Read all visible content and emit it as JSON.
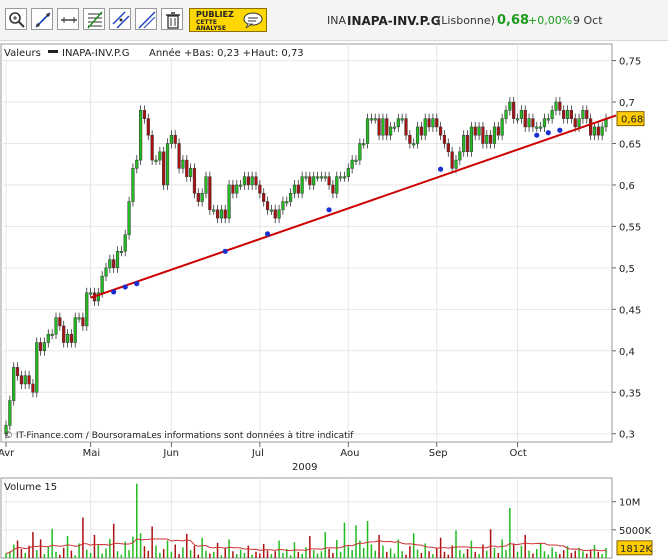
{
  "header": {
    "ticker": "INA",
    "name": "INAPA-INV.P.G",
    "exchange": "(Lisbonne)",
    "price": "0,68",
    "change": "+0,00%",
    "date": "9 Oct",
    "ad_line1": "PUBLIEZ",
    "ad_line2": "CETTE",
    "ad_line3": "ANALYSE"
  },
  "toolbar": [
    {
      "icon": "zoom-icon"
    },
    {
      "icon": "trendline-icon"
    },
    {
      "icon": "horizontal-line-icon"
    },
    {
      "icon": "fibonacci-icon"
    },
    {
      "icon": "channel-icon"
    },
    {
      "icon": "parallel-line-icon"
    },
    {
      "icon": "trash-icon"
    }
  ],
  "colors": {
    "up": "#22bb22",
    "down": "#aa1111",
    "trend": "#cc0000",
    "price_tag": "#ffcc00",
    "volume_avg": "#cc3333"
  },
  "chart_data": [
    {
      "type": "candlestick",
      "legend_label": "Valeurs",
      "series_name": "INAPA-INV.P.G",
      "legend_stats": "Année +Bas: 0,23 +Haut: 0,73",
      "credit": "© IT-Finance.com / BoursoramaLes informations sont données à titre indicatif",
      "x_ticks": [
        "Avr",
        "Mai",
        "Jun",
        "Jul",
        "Aou",
        "Sep",
        "Oct"
      ],
      "x_year": "2009",
      "y_ticks": [
        "0,75",
        "0,7",
        "0,65",
        "0,6",
        "0,55",
        "0,5",
        "0,45",
        "0,4",
        "0,35",
        "0,3"
      ],
      "y_tick_values": [
        0.75,
        0.7,
        0.65,
        0.6,
        0.55,
        0.5,
        0.45,
        0.4,
        0.35,
        0.3
      ],
      "ylim": [
        0.29,
        0.77
      ],
      "last_price_label": "0,68",
      "last_price_value": 0.68,
      "trendline": [
        [
          0.464,
          0.464
        ],
        [
          0.685,
          0.685
        ]
      ],
      "trendline_day": [
        22,
        153
      ],
      "touch_points": [
        [
          28,
          0.471
        ],
        [
          31,
          0.477
        ],
        [
          34,
          0.481
        ],
        [
          57,
          0.52
        ],
        [
          68,
          0.541
        ],
        [
          84,
          0.57
        ],
        [
          113,
          0.619
        ],
        [
          138,
          0.66
        ],
        [
          141,
          0.663
        ],
        [
          144,
          0.666
        ]
      ],
      "day_range": [
        0,
        156
      ],
      "close": [
        0.31,
        0.34,
        0.38,
        0.37,
        0.36,
        0.37,
        0.36,
        0.35,
        0.41,
        0.4,
        0.41,
        0.42,
        0.42,
        0.44,
        0.43,
        0.41,
        0.42,
        0.41,
        0.44,
        0.44,
        0.43,
        0.47,
        0.47,
        0.46,
        0.47,
        0.49,
        0.5,
        0.51,
        0.5,
        0.52,
        0.52,
        0.54,
        0.58,
        0.62,
        0.63,
        0.69,
        0.68,
        0.66,
        0.63,
        0.63,
        0.64,
        0.6,
        0.65,
        0.66,
        0.65,
        0.62,
        0.63,
        0.61,
        0.62,
        0.59,
        0.58,
        0.59,
        0.61,
        0.57,
        0.57,
        0.56,
        0.57,
        0.56,
        0.6,
        0.59,
        0.6,
        0.6,
        0.61,
        0.6,
        0.61,
        0.6,
        0.59,
        0.58,
        0.57,
        0.57,
        0.56,
        0.57,
        0.58,
        0.58,
        0.59,
        0.6,
        0.59,
        0.61,
        0.61,
        0.6,
        0.61,
        0.61,
        0.61,
        0.61,
        0.6,
        0.59,
        0.61,
        0.61,
        0.61,
        0.62,
        0.63,
        0.63,
        0.65,
        0.65,
        0.68,
        0.68,
        0.68,
        0.66,
        0.68,
        0.66,
        0.67,
        0.67,
        0.68,
        0.68,
        0.66,
        0.65,
        0.65,
        0.67,
        0.66,
        0.68,
        0.67,
        0.68,
        0.67,
        0.66,
        0.65,
        0.64,
        0.62,
        0.63,
        0.64,
        0.66,
        0.64,
        0.67,
        0.66,
        0.67,
        0.65,
        0.66,
        0.65,
        0.67,
        0.66,
        0.68,
        0.69,
        0.7,
        0.68,
        0.68,
        0.69,
        0.67,
        0.68,
        0.67,
        0.67,
        0.67,
        0.68,
        0.68,
        0.69,
        0.7,
        0.69,
        0.68,
        0.69,
        0.68,
        0.67,
        0.68,
        0.69,
        0.68,
        0.66,
        0.67,
        0.66,
        0.67,
        0.68
      ],
      "volume_title": "Volume 15",
      "volume_ticks": [
        "10M",
        "5000K"
      ],
      "volume_tick_values": [
        10,
        5
      ],
      "volume_last_label": "1812K",
      "volume_last": 1.812,
      "volume_max": 13.5,
      "volume_millions": [
        0.8,
        1.2,
        2.4,
        3.1,
        1.6,
        0.9,
        2.2,
        4.6,
        1.4,
        3.3,
        0.7,
        2.1,
        5.2,
        1.1,
        0.6,
        1.8,
        3.9,
        1.3,
        0.5,
        2.6,
        7.2,
        1.5,
        0.9,
        4.1,
        2.3,
        0.8,
        1.7,
        3.4,
        6.1,
        1.2,
        0.6,
        2.9,
        1.4,
        3.8,
        13.2,
        4.4,
        2.1,
        1.3,
        5.6,
        2.2,
        0.9,
        1.6,
        3.1,
        1.1,
        2.4,
        0.7,
        1.9,
        4.3,
        1.4,
        2.2,
        0.6,
        3.6,
        1.3,
        0.8,
        1.1,
        2.7,
        0.5,
        1.8,
        3.3,
        1.2,
        0.7,
        1.5,
        0.9,
        2.2,
        0.6,
        1.1,
        0.8,
        2.5,
        1.3,
        0.7,
        1.2,
        3.1,
        0.9,
        1.6,
        0.5,
        2.8,
        1.1,
        0.7,
        1.9,
        3.9,
        1.4,
        0.8,
        1.2,
        4.6,
        1.6,
        0.9,
        3.2,
        1.1,
        6.3,
        2.1,
        1.4,
        5.8,
        3.1,
        1.8,
        6.6,
        2.4,
        1.3,
        4.1,
        2.2,
        1.1,
        1.7,
        0.8,
        3.3,
        1.2,
        0.6,
        2.1,
        4.4,
        1.5,
        0.9,
        2.6,
        1.2,
        0.7,
        1.8,
        3.6,
        1.1,
        0.6,
        2.2,
        4.9,
        1.4,
        0.8,
        1.6,
        3.1,
        1.1,
        0.7,
        2.4,
        1.3,
        5.1,
        1.8,
        0.9,
        3.3,
        1.4,
        8.9,
        2.6,
        1.1,
        2.2,
        4.1,
        1.3,
        0.8,
        1.6,
        2.7,
        1.2,
        0.6,
        1.9,
        1.1,
        0.7,
        1.4,
        2.1,
        0.9,
        1.3,
        1.8,
        1.2,
        0.8,
        1.5,
        2.3,
        1.1,
        0.7,
        1.8
      ]
    }
  ]
}
